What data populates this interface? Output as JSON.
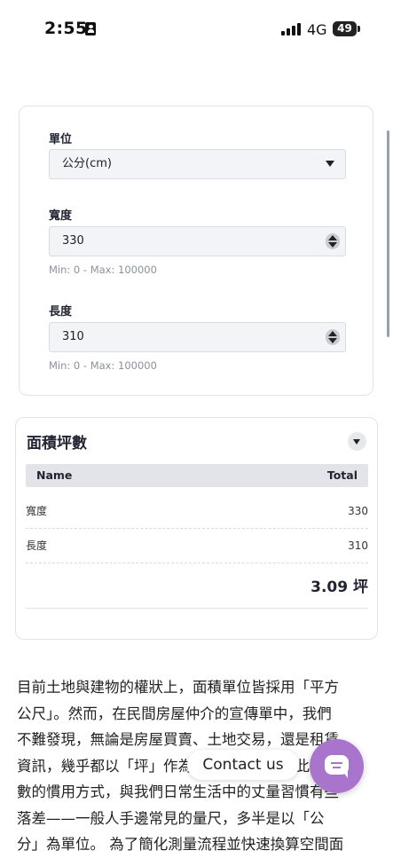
{
  "status_bar": {
    "time": "2:55",
    "network": "4G",
    "battery": "49"
  },
  "form": {
    "unit": {
      "label": "單位",
      "selected": "公分(cm)"
    },
    "width": {
      "label": "寬度",
      "value": "330",
      "hint": "Min: 0 - Max: 100000"
    },
    "length": {
      "label": "長度",
      "value": "310",
      "hint": "Min: 0 - Max: 100000"
    }
  },
  "result": {
    "title": "面積坪數",
    "columns": {
      "name": "Name",
      "total": "Total"
    },
    "rows": [
      {
        "name": "寬度",
        "total": "330"
      },
      {
        "name": "長度",
        "total": "310"
      }
    ],
    "total": "3.09 坪"
  },
  "article": {
    "lines": [
      "目前土地與建物的權狀上，面積單位皆採用「平方",
      "公尺」。然而，在民間房屋仲介的宣傳單中，我們",
      "不難發現，無論是房屋買賣、土地交易，還是租賃",
      "資訊，幾乎都以「坪」作為主要計量單位，此種坪",
      "數的慣用方式，與我們日常生活中的丈量習慣有些",
      "落差——一般人手邊常見的量尺，多半是以「公",
      "分」為單位。 為了簡化測量流程並快速換算空間面"
    ]
  },
  "contact": {
    "label": "Contact us"
  },
  "colors": {
    "accent": "#a874cc",
    "card_border": "#e0e3ea",
    "table_header": "#e2e4e9"
  }
}
